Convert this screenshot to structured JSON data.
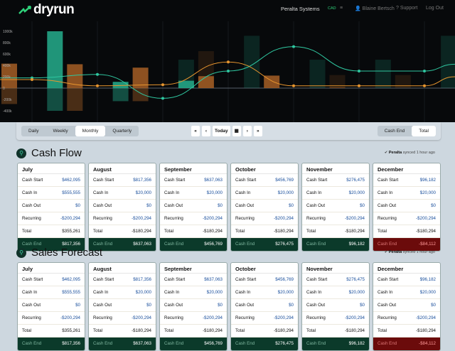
{
  "header": {
    "brand": "dryrun",
    "company": "Peralta Systems",
    "currency": "CAD",
    "user": "Blaine Bertsch",
    "support": "Support",
    "logout": "Log Out"
  },
  "chart_data": {
    "type": "bar",
    "yticks": [
      "1000k",
      "800k",
      "600k",
      "400k",
      "200k",
      "0",
      "-200k",
      "-400k"
    ],
    "ylim": [
      -500,
      1100
    ],
    "units": "k",
    "bars": [
      {
        "group": 0,
        "series": "out",
        "value": 430,
        "neg": -280
      },
      {
        "group": 1,
        "series": "in",
        "value": 1000,
        "neg": -400
      },
      {
        "group": 1,
        "series": "out",
        "value": 420,
        "neg": -400
      },
      {
        "group": 2,
        "series": "in",
        "value": 110,
        "neg": -230
      },
      {
        "group": 2,
        "series": "out",
        "value": 360,
        "neg": -230
      },
      {
        "group": 3,
        "series": "in",
        "value": 130,
        "ghost": 500
      },
      {
        "group": 3,
        "series": "out",
        "value": 210,
        "ghost": 650
      },
      {
        "group": 4,
        "series": "in",
        "value": 0,
        "ghost": 920
      },
      {
        "group": 4,
        "series": "out",
        "value": 220
      },
      {
        "group": 5,
        "series": "in",
        "value": 0,
        "ghost": 500
      },
      {
        "group": 5,
        "series": "out",
        "value": 10,
        "ghost": 230
      },
      {
        "group": 6,
        "series": "in",
        "value": 0,
        "ghost": 500
      },
      {
        "group": 6,
        "series": "out",
        "value": 0,
        "ghost": 230
      },
      {
        "group": 7,
        "series": "in",
        "value": 0,
        "ghost": 920
      }
    ],
    "lines": [
      {
        "name": "cash-end",
        "color": "#2fc7a0",
        "values": [
          180,
          240,
          -180,
          300,
          730,
          300,
          300,
          420
        ]
      },
      {
        "name": "total",
        "color": "#e8962f",
        "values": [
          150,
          40,
          60,
          460,
          40,
          40,
          40,
          200
        ]
      }
    ],
    "colors": {
      "in": "#23a585",
      "out": "#9c5a23"
    }
  },
  "toolbar": {
    "periods": [
      "Daily",
      "Weekly",
      "Monthly",
      "Quarterly"
    ],
    "active_period": "Monthly",
    "nav": [
      "«",
      "‹",
      "Today",
      "▦",
      "›",
      "»"
    ],
    "modes": [
      "Cash End",
      "Total"
    ],
    "active_mode": "Total"
  },
  "sections": [
    {
      "title": "Cash Flow",
      "sync_source": "Peralta",
      "sync_text": "synced 1 hour ago"
    },
    {
      "title": "Sales Forecast",
      "sync_source": "Peralta",
      "sync_text": "synced 1 hour ago"
    }
  ],
  "labels": {
    "start": "Cash Start",
    "in": "Cash In",
    "out": "Cash Out",
    "rec": "Recurring",
    "total": "Total",
    "end": "Cash End"
  },
  "months": [
    {
      "name": "July",
      "start": "$462,095",
      "in": "$555,555",
      "out": "$0",
      "rec": "-$200,294",
      "total": "$355,261",
      "end": "$817,356",
      "neg": false
    },
    {
      "name": "August",
      "start": "$817,356",
      "in": "$20,000",
      "out": "$0",
      "rec": "-$200,294",
      "total": "-$180,294",
      "end": "$637,063",
      "neg": false
    },
    {
      "name": "September",
      "start": "$637,063",
      "in": "$20,000",
      "out": "$0",
      "rec": "-$200,294",
      "total": "-$180,294",
      "end": "$456,769",
      "neg": false
    },
    {
      "name": "October",
      "start": "$456,769",
      "in": "$20,000",
      "out": "$0",
      "rec": "-$200,294",
      "total": "-$180,294",
      "end": "$276,475",
      "neg": false
    },
    {
      "name": "November",
      "start": "$276,475",
      "in": "$20,000",
      "out": "$0",
      "rec": "-$200,294",
      "total": "-$180,294",
      "end": "$96,182",
      "neg": false
    },
    {
      "name": "December",
      "start": "$96,182",
      "in": "$20,000",
      "out": "$0",
      "rec": "-$200,294",
      "total": "-$180,294",
      "end": "-$84,112",
      "neg": true
    }
  ]
}
